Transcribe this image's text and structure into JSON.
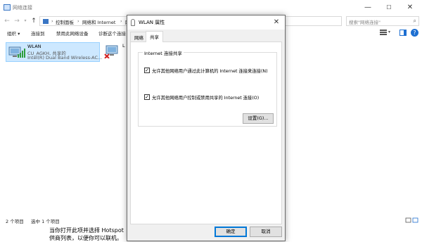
{
  "explorer": {
    "title": "网络连接",
    "window_controls": [
      "—",
      "☐",
      "✕"
    ],
    "breadcrumb": [
      "控制面板",
      "网络和 Internet",
      "网"
    ],
    "search_placeholder": "搜索\"网络连接\"",
    "toolbar": [
      "组织 ▾",
      "连接到",
      "禁用此网络设备",
      "诊断这个连接"
    ],
    "network_items": [
      {
        "name": "WLAN",
        "status": "CU_AGKH, 共享的",
        "adapter": "Intel(R) Dual Band Wireless-AC..."
      },
      {
        "name": "L"
      }
    ],
    "status_bar": {
      "count": "2 个项目",
      "selected": "选中 1 个项目"
    }
  },
  "below_text": {
    "line1": "当你打开此项并选择 Hotspot",
    "line2": "供商列表，以便你可以联机。"
  },
  "dialog": {
    "title": "WLAN 属性",
    "close_label": "✕",
    "tabs": [
      {
        "label": "网络",
        "active": false
      },
      {
        "label": "共享",
        "active": true
      }
    ],
    "group_title": "Internet 连接共享",
    "options": [
      {
        "label": "允许其他网络用户通过此计算机的 Internet 连接来连接(N)",
        "checked": true
      },
      {
        "label": "允许其他网络用户控制或禁用共享的 Internet 连接(O)",
        "checked": true
      }
    ],
    "settings_button": "设置(G)...",
    "ok_button": "确定",
    "cancel_button": "取消"
  },
  "colors": {
    "accent": "#0078d7",
    "selection_bg": "#cde8ff",
    "dialog_bg": "#f0f0f0"
  },
  "icons": [
    "network-icon",
    "wifi-adapter-icon",
    "ethernet-adapter-icon",
    "wifi-signal-icon",
    "search-icon",
    "help-icon",
    "close-icon",
    "minimize-icon",
    "maximize-icon",
    "back-arrow-icon",
    "forward-arrow-icon",
    "up-arrow-icon",
    "refresh-icon",
    "view-options-icon",
    "preview-pane-icon"
  ]
}
